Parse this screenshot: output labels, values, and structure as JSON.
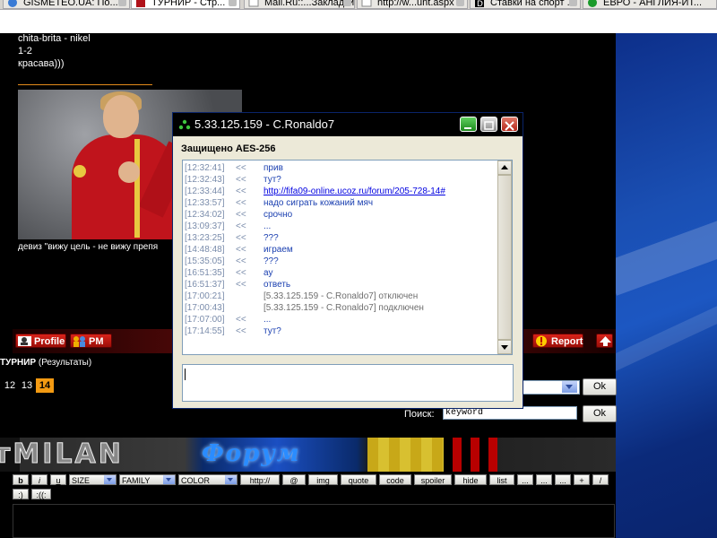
{
  "browser": {
    "tabs": [
      {
        "label": "GISMETEO.UA: По..."
      },
      {
        "label": "ТУРНИР - Стр..."
      },
      {
        "label": "Mail.Ru::...Закладки"
      },
      {
        "label": "http://w...unt.aspx"
      },
      {
        "label": "Ставки на спорт ..."
      },
      {
        "label": "ЕВРО - АНГЛИЯ-ИТ..."
      }
    ],
    "active_tab_index": 1
  },
  "post": {
    "lines": [
      "chita-brita - nikel",
      "1-2",
      "красава)))"
    ],
    "motto": "девиз \"вижу цель - не вижу препя",
    "buttons": {
      "profile": "Profile",
      "pm": "PM",
      "report": "Report"
    }
  },
  "tournament": {
    "title": "ТУРНИР",
    "subtitle": "(Результаты)",
    "pages": [
      "12",
      "13",
      "14"
    ],
    "current_page": "14"
  },
  "forms": {
    "ok_label": "Ok",
    "search_label": "Поиск:",
    "search_value": "keyword"
  },
  "banner": {
    "left_text": "MILAN",
    "prefix": "т"
  },
  "bbcode": {
    "row1": [
      "b",
      "i",
      "u"
    ],
    "selects": [
      "SIZE",
      "FAMILY",
      "COLOR"
    ],
    "row1b": [
      "http://",
      "@",
      "img",
      "quote",
      "code",
      "spoiler",
      "hide",
      "list",
      "...",
      "...",
      "...",
      "+",
      "/"
    ],
    "row2": [
      ":)",
      ":((:"
    ]
  },
  "chat": {
    "title": "5.33.125.159 - C.Ronaldo7",
    "security": "Защищено AES-256",
    "messages": [
      {
        "time": "[12:32:41]",
        "dir": "<<",
        "text": "прив",
        "kind": "msg"
      },
      {
        "time": "[12:32:43]",
        "dir": "<<",
        "text": "тут?",
        "kind": "msg"
      },
      {
        "time": "[12:33:44]",
        "dir": "<<",
        "text": "http://fifa09-online.ucoz.ru/forum/205-728-14#",
        "kind": "link"
      },
      {
        "time": "[12:33:57]",
        "dir": "<<",
        "text": "надо сиграть кожаний мяч",
        "kind": "msg"
      },
      {
        "time": "[12:34:02]",
        "dir": "<<",
        "text": "срочно",
        "kind": "msg"
      },
      {
        "time": "[13:09:37]",
        "dir": "<<",
        "text": "...",
        "kind": "msg"
      },
      {
        "time": "[13:23:25]",
        "dir": "<<",
        "text": "???",
        "kind": "msg"
      },
      {
        "time": "[14:48:48]",
        "dir": "<<",
        "text": "играем",
        "kind": "msg"
      },
      {
        "time": "[15:35:05]",
        "dir": "<<",
        "text": "???",
        "kind": "msg"
      },
      {
        "time": "[16:51:35]",
        "dir": "<<",
        "text": "ау",
        "kind": "msg"
      },
      {
        "time": "[16:51:37]",
        "dir": "<<",
        "text": "ответь",
        "kind": "msg"
      },
      {
        "time": "[17:00:21]",
        "dir": "",
        "text": "[5.33.125.159 - C.Ronaldo7] отключен",
        "kind": "sys"
      },
      {
        "time": "[17:00:43]",
        "dir": "",
        "text": "[5.33.125.159 - C.Ronaldo7] подключен",
        "kind": "sys"
      },
      {
        "time": "[17:07:00]",
        "dir": "<<",
        "text": "...",
        "kind": "msg"
      },
      {
        "time": "[17:14:55]",
        "dir": "<<",
        "text": "тут?",
        "kind": "msg"
      }
    ],
    "input_value": ""
  },
  "colors": {
    "accent_orange": "#f39a12",
    "chat_text_blue": "#1a3fb0",
    "button_red": "#d9231a",
    "link_blue": "#0000e0"
  },
  "icons": {
    "chat_title": "green-status-icon",
    "window_buttons": [
      "minimize-icon",
      "maximize-icon",
      "close-icon"
    ],
    "profile": "user-card-icon",
    "pm": "users-icon",
    "report": "exclamation-icon",
    "up": "arrow-up-icon"
  }
}
